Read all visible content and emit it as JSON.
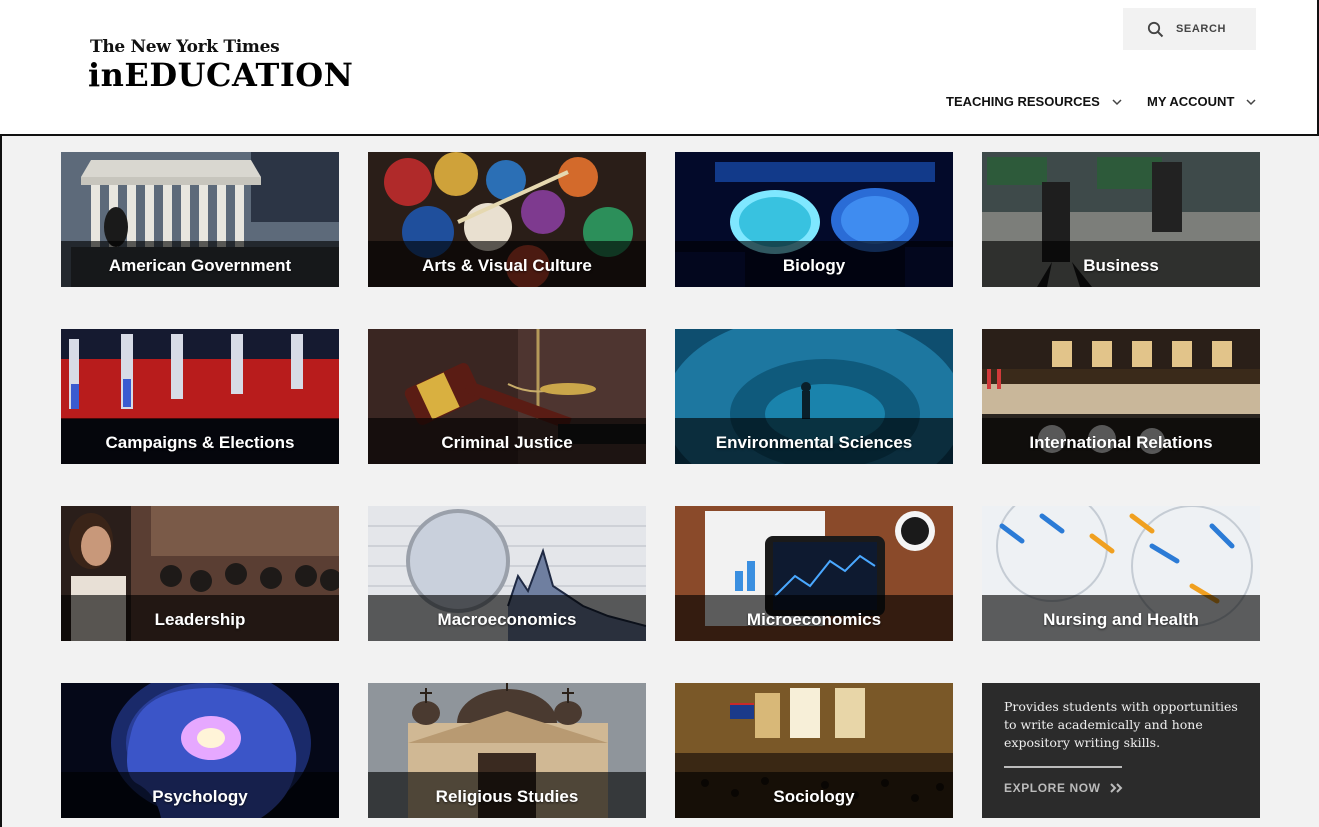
{
  "brand": {
    "top": "The New York Times",
    "main": "inEDUCATION"
  },
  "search": {
    "label": "SEARCH",
    "icon": "search-icon"
  },
  "nav": {
    "teaching": "TEACHING RESOURCES",
    "account": "MY ACCOUNT"
  },
  "subjects": [
    {
      "label": "American Government",
      "icon": "courthouse-photo"
    },
    {
      "label": "Arts & Visual Culture",
      "icon": "paint-cups-photo"
    },
    {
      "label": "Biology",
      "icon": "petri-dish-photo"
    },
    {
      "label": "Business",
      "icon": "wall-street-photo"
    },
    {
      "label": "Campaigns & Elections",
      "icon": "debate-stage-photo"
    },
    {
      "label": "Criminal Justice",
      "icon": "gavel-photo"
    },
    {
      "label": "Environmental Sciences",
      "icon": "fish-school-photo"
    },
    {
      "label": "International Relations",
      "icon": "conference-hall-photo"
    },
    {
      "label": "Leadership",
      "icon": "speaker-photo"
    },
    {
      "label": "Macroeconomics",
      "icon": "stock-chart-photo"
    },
    {
      "label": "Microeconomics",
      "icon": "tablet-chart-photo"
    },
    {
      "label": "Nursing and Health",
      "icon": "petri-glass-photo"
    },
    {
      "label": "Psychology",
      "icon": "brain-photo"
    },
    {
      "label": "Religious Studies",
      "icon": "church-photo"
    },
    {
      "label": "Sociology",
      "icon": "grand-central-photo"
    }
  ],
  "promo": {
    "text": "Provides students with opportunities to write academically and hone expository writing skills.",
    "link": "EXPLORE NOW"
  },
  "colors": {
    "header_bg": "#ffffff",
    "main_bg": "#f2f2f2",
    "label_band": "rgba(0,0,0,0.62)",
    "promo_bg": "#2b2b2b"
  }
}
